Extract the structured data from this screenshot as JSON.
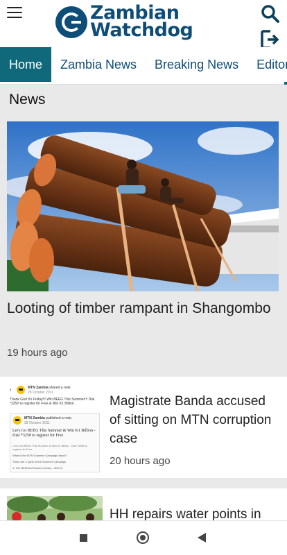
{
  "header": {
    "logo_line1": "Zambian",
    "logo_line2": "Watchdog",
    "menu_icon": "hamburger-menu-icon",
    "search_icon": "search-icon",
    "logout_icon": "logout-icon"
  },
  "tabs": [
    {
      "label": "Home",
      "active": true
    },
    {
      "label": "Zambia News",
      "active": false
    },
    {
      "label": "Breaking News",
      "active": false
    },
    {
      "label": "Editor's",
      "active": false
    }
  ],
  "section": {
    "title": "News"
  },
  "feature": {
    "title": "Looting of timber rampant in Shangombo",
    "time": "19 hours ago"
  },
  "articles": [
    {
      "title": "Magistrate Banda accused of sitting on MTN corruption case",
      "time": "20 hours ago",
      "thumb": {
        "page_name": "MTN Zambia",
        "action": "shared a note.",
        "date": "28 October 2011",
        "post_text": "Thank God It's Friday!!! Win BEEG This Summer!!! Dial *325# to register for Free & Win K1 Billion.",
        "inner_name": "MTN Zambia",
        "inner_action": "published a note.",
        "inner_date": "28 October 2011",
        "inner_head": "Let's Go BEEG This Summer & Win K1 Billion - Dial *325# to register for Free",
        "inner_sub": "Let's Go BEEG This Summer & Win K1 Billion - Dial *325# to register for Free",
        "inner_q": "What is the MTN Summer Campaign about?",
        "inner_parts": "There are 2 parts to the Summer Campaign",
        "inner_item": "1. The BEEGest Summer Draw – Win K1"
      }
    },
    {
      "title": "HH repairs water points in",
      "time": ""
    }
  ],
  "navbar": {
    "recents_icon": "recents-square-icon",
    "home_icon": "home-circle-icon",
    "back_icon": "back-triangle-icon"
  },
  "colors": {
    "brand": "#0e4d77",
    "active_tab": "#10697a",
    "background": "#e9e9e9"
  }
}
